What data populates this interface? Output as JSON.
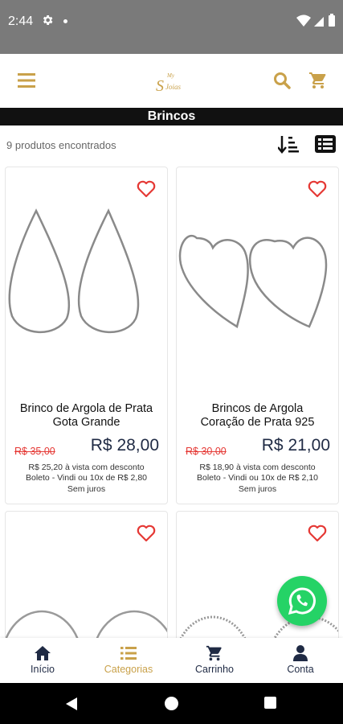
{
  "status_bar": {
    "time": "2:44"
  },
  "header": {
    "logo_alt": "Joias logo"
  },
  "page": {
    "title": "Brincos",
    "result_count": "9 produtos encontrados"
  },
  "products": [
    {
      "name_line1": "Brinco de Argola de Prata",
      "name_line2": "Gota Grande",
      "old_price": "R$ 35,00",
      "price": "R$ 28,00",
      "cash_text": "R$ 25,20 à vista com desconto",
      "boleto_text": "Boleto - Vindi ou 10x de R$ 2,80",
      "juros_text": "Sem juros"
    },
    {
      "name_line1": "Brincos de Argola",
      "name_line2": "Coração de Prata 925",
      "old_price": "R$ 30,00",
      "price": "R$ 21,00",
      "cash_text": "R$ 18,90 à vista com desconto",
      "boleto_text": "Boleto - Vindi ou 10x de R$ 2,10",
      "juros_text": "Sem juros"
    }
  ],
  "bottom_nav": {
    "items": [
      {
        "label": "Início"
      },
      {
        "label": "Categorias"
      },
      {
        "label": "Carrinho"
      },
      {
        "label": "Conta"
      }
    ],
    "active": "Categorias"
  },
  "colors": {
    "navy": "#1f2a44",
    "gold": "#c9a14a",
    "sale_red": "#e53935",
    "heart_red": "#e53935",
    "whatsapp": "#25d366"
  }
}
